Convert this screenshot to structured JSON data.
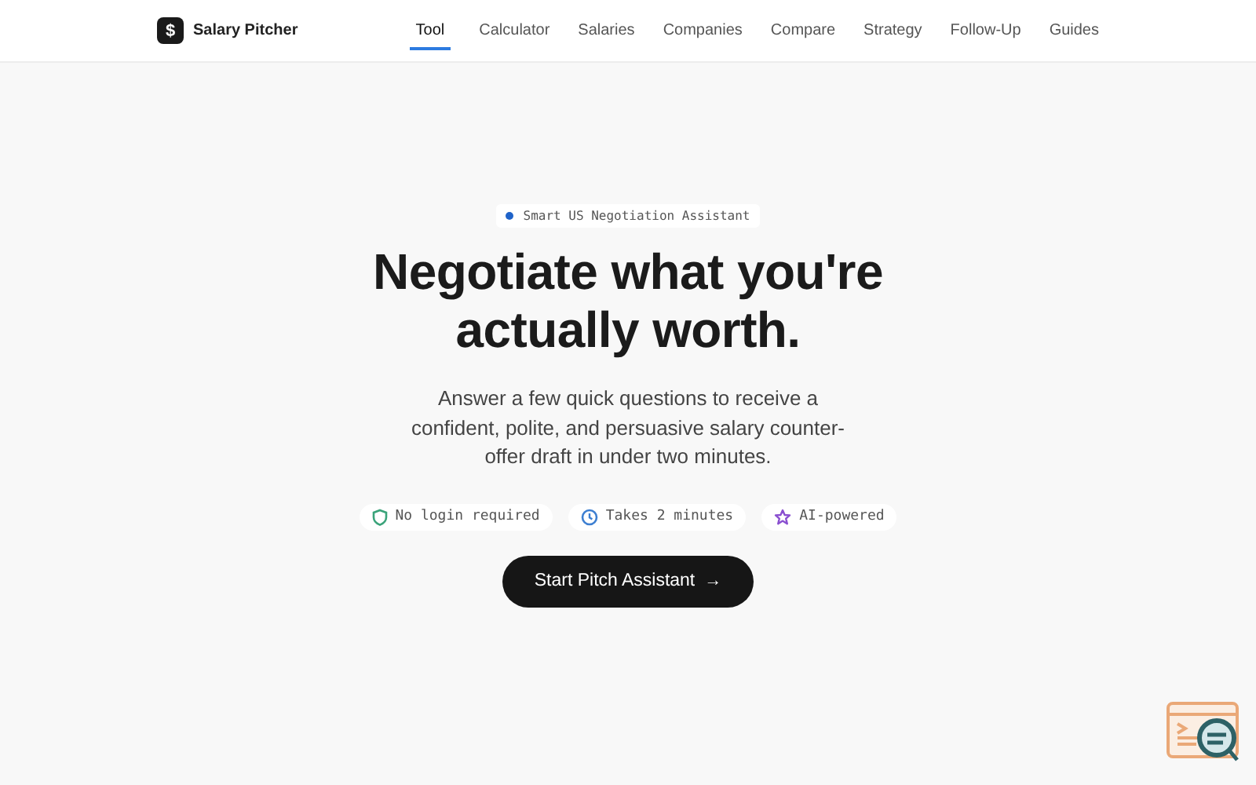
{
  "brand": {
    "logo": "$",
    "name": "Salary Pitcher"
  },
  "nav": [
    {
      "label": "Tool",
      "selected": true
    },
    {
      "label": "Calculator",
      "selected": false
    },
    {
      "label": "Salaries",
      "selected": false
    },
    {
      "label": "Companies",
      "selected": false
    },
    {
      "label": "Compare",
      "selected": false
    },
    {
      "label": "Strategy",
      "selected": false
    },
    {
      "label": "Follow-Up",
      "selected": false
    },
    {
      "label": "Guides",
      "selected": false
    }
  ],
  "hero": {
    "badge": "Smart US Negotiation Assistant",
    "title": "Negotiate what you're actually worth.",
    "subtitle": "Answer a few quick questions to receive a confident, polite, and persuasive salary counter-offer draft in under two minutes.",
    "features": [
      {
        "kind": "shield",
        "label": "No login required"
      },
      {
        "kind": "clock",
        "label": "Takes 2 minutes"
      },
      {
        "kind": "star",
        "label": "AI-powered"
      }
    ],
    "button": {
      "label": "Start Pitch Assistant",
      "arrow": "→"
    }
  }
}
